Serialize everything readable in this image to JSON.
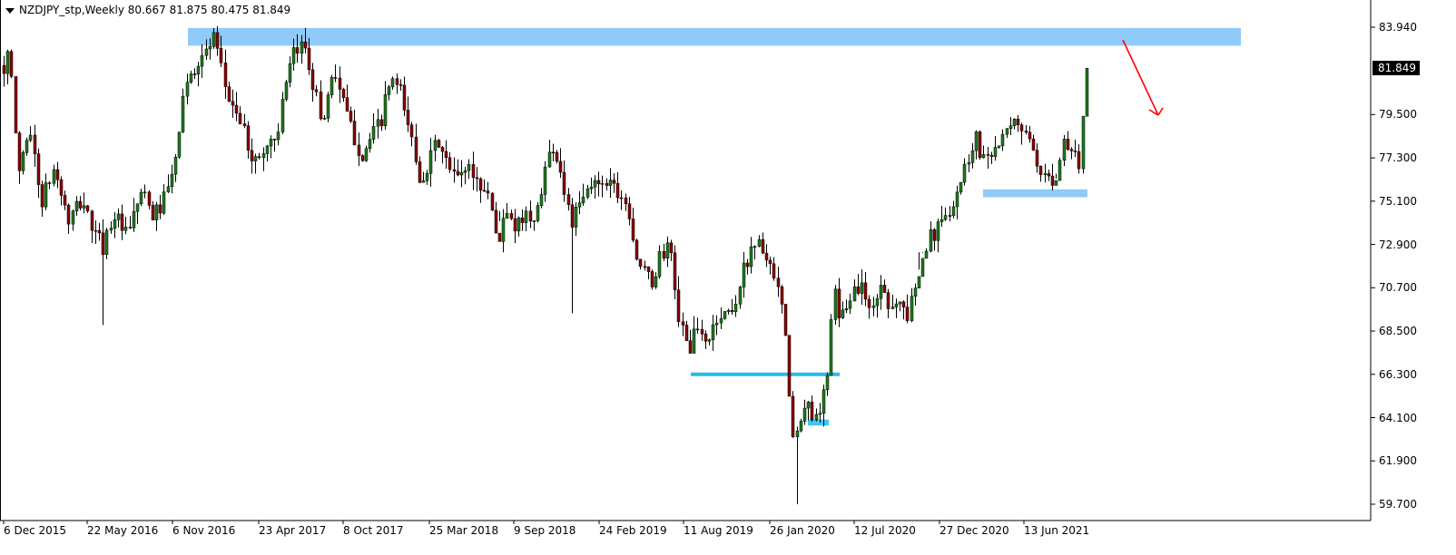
{
  "header": {
    "title": "NZDJPY_stp,Weekly  80.667 81.875 80.475 81.849"
  },
  "chart_data": {
    "type": "candlestick",
    "symbol": "NZDJPY_stp",
    "timeframe": "Weekly",
    "last_quote": {
      "open": 80.667,
      "high": 81.875,
      "low": 80.475,
      "close": 81.849
    },
    "current_price_label": "81.849",
    "y_ticks": [
      "83.940",
      "81.849",
      "79.500",
      "77.300",
      "75.100",
      "72.900",
      "70.700",
      "68.500",
      "66.300",
      "64.100",
      "61.900",
      "59.700"
    ],
    "x_ticks": [
      "6 Dec 2015",
      "22 May 2016",
      "6 Nov 2016",
      "23 Apr 2017",
      "8 Oct 2017",
      "25 Mar 2018",
      "9 Sep 2018",
      "24 Feb 2019",
      "11 Aug 2019",
      "26 Jan 2020",
      "12 Jul 2020",
      "27 Dec 2020",
      "13 Jun 2021"
    ],
    "ylim": [
      59.3,
      84.7
    ],
    "path_points": [
      [
        0,
        81.6
      ],
      [
        10,
        82.6
      ],
      [
        20,
        76.5
      ],
      [
        32,
        79.0
      ],
      [
        45,
        75.0
      ],
      [
        60,
        76.8
      ],
      [
        75,
        74.0
      ],
      [
        90,
        75.2
      ],
      [
        103,
        73.5
      ],
      [
        113,
        72.8
      ],
      [
        125,
        74.5
      ],
      [
        140,
        73.2
      ],
      [
        155,
        75.6
      ],
      [
        168,
        74.3
      ],
      [
        180,
        75.1
      ],
      [
        193,
        77.0
      ],
      [
        200,
        80.2
      ],
      [
        212,
        81.8
      ],
      [
        225,
        82.6
      ],
      [
        235,
        83.3
      ],
      [
        242,
        82.0
      ],
      [
        250,
        80.5
      ],
      [
        262,
        79.5
      ],
      [
        272,
        78.0
      ],
      [
        282,
        77.0
      ],
      [
        292,
        77.9
      ],
      [
        304,
        78.4
      ],
      [
        314,
        80.7
      ],
      [
        322,
        82.4
      ],
      [
        335,
        83.2
      ],
      [
        345,
        81.0
      ],
      [
        355,
        79.0
      ],
      [
        367,
        82.0
      ],
      [
        378,
        80.0
      ],
      [
        388,
        78.6
      ],
      [
        398,
        77.4
      ],
      [
        408,
        78.2
      ],
      [
        420,
        79.3
      ],
      [
        430,
        81.3
      ],
      [
        440,
        80.7
      ],
      [
        452,
        78.5
      ],
      [
        462,
        76.3
      ],
      [
        472,
        77.0
      ],
      [
        482,
        78.2
      ],
      [
        492,
        76.9
      ],
      [
        504,
        76.2
      ],
      [
        514,
        77.0
      ],
      [
        528,
        75.9
      ],
      [
        538,
        75.5
      ],
      [
        548,
        73.0
      ],
      [
        558,
        74.5
      ],
      [
        568,
        73.4
      ],
      [
        578,
        74.8
      ],
      [
        588,
        73.8
      ],
      [
        598,
        76.3
      ],
      [
        608,
        78.0
      ],
      [
        616,
        77.0
      ],
      [
        622,
        75.5
      ],
      [
        630,
        74.0
      ],
      [
        640,
        75.0
      ],
      [
        650,
        75.8
      ],
      [
        660,
        76.2
      ],
      [
        670,
        76.2
      ],
      [
        682,
        75.6
      ],
      [
        692,
        74.8
      ],
      [
        700,
        72.5
      ],
      [
        708,
        71.5
      ],
      [
        718,
        70.9
      ],
      [
        728,
        72.5
      ],
      [
        738,
        72.6
      ],
      [
        748,
        69.0
      ],
      [
        758,
        67.6
      ],
      [
        768,
        68.5
      ],
      [
        778,
        67.9
      ],
      [
        790,
        69.2
      ],
      [
        800,
        69.4
      ],
      [
        810,
        70.0
      ],
      [
        820,
        71.8
      ],
      [
        830,
        73.1
      ],
      [
        840,
        72.7
      ],
      [
        848,
        71.5
      ],
      [
        856,
        70.6
      ],
      [
        862,
        69.5
      ],
      [
        867,
        66.8
      ],
      [
        874,
        62.6
      ],
      [
        880,
        63.5
      ],
      [
        888,
        64.8
      ],
      [
        895,
        64.3
      ],
      [
        902,
        64.6
      ],
      [
        910,
        65.5
      ],
      [
        918,
        70.5
      ],
      [
        926,
        69.0
      ],
      [
        934,
        70.2
      ],
      [
        944,
        70.8
      ],
      [
        954,
        70.4
      ],
      [
        962,
        69.4
      ],
      [
        970,
        71.0
      ],
      [
        978,
        70.0
      ],
      [
        990,
        70.0
      ],
      [
        1000,
        69.2
      ],
      [
        1008,
        70.8
      ],
      [
        1016,
        72.6
      ],
      [
        1026,
        73.3
      ],
      [
        1038,
        74.0
      ],
      [
        1048,
        75.0
      ],
      [
        1058,
        76.1
      ],
      [
        1066,
        77.3
      ],
      [
        1074,
        78.5
      ],
      [
        1082,
        77.3
      ],
      [
        1090,
        77.7
      ],
      [
        1100,
        78.0
      ],
      [
        1110,
        78.5
      ],
      [
        1120,
        79.2
      ],
      [
        1130,
        78.6
      ],
      [
        1138,
        77.3
      ],
      [
        1146,
        76.0
      ],
      [
        1154,
        76.5
      ],
      [
        1162,
        76.2
      ],
      [
        1170,
        78.2
      ],
      [
        1180,
        77.8
      ],
      [
        1188,
        77.0
      ],
      [
        1196,
        80.7
      ],
      [
        1200,
        81.849
      ]
    ],
    "ranges": [
      [
        0,
        15,
        76.3,
        82.8
      ],
      [
        15,
        110,
        72.2,
        80.1
      ],
      [
        110,
        200,
        72.0,
        78.2
      ],
      [
        200,
        260,
        78.0,
        84.0
      ],
      [
        260,
        360,
        76.5,
        84.0
      ],
      [
        360,
        450,
        76.3,
        82.8
      ],
      [
        450,
        550,
        74.6,
        80.0
      ],
      [
        550,
        630,
        72.5,
        79.4
      ],
      [
        630,
        700,
        73.0,
        77.0
      ],
      [
        700,
        760,
        68.0,
        73.3
      ],
      [
        760,
        870,
        67.5,
        73.5
      ],
      [
        870,
        915,
        59.7,
        66.4
      ],
      [
        915,
        1010,
        68.7,
        72.9
      ],
      [
        1010,
        1080,
        72.5,
        78.7
      ],
      [
        1080,
        1160,
        75.0,
        80.0
      ],
      [
        1160,
        1200,
        76.5,
        81.9
      ]
    ],
    "zones": [
      {
        "x1": 207,
        "x2": 1367,
        "top": 83.9,
        "bottom": 83.0,
        "color": "#90caf9"
      },
      {
        "x1": 1083,
        "x2": 1198,
        "top": 75.7,
        "bottom": 75.3,
        "color": "#90caf9"
      },
      {
        "x1": 890,
        "x2": 913,
        "top": 64.0,
        "bottom": 63.7,
        "color": "#42c5f5"
      }
    ],
    "support_line": {
      "x1": 761,
      "x2": 925,
      "y": 66.3,
      "color": "#26bcee"
    },
    "arrow": {
      "color": "#ff0000"
    },
    "bull_color": "#1e7a1e",
    "bear_color": "#8b0000",
    "grid": false
  }
}
